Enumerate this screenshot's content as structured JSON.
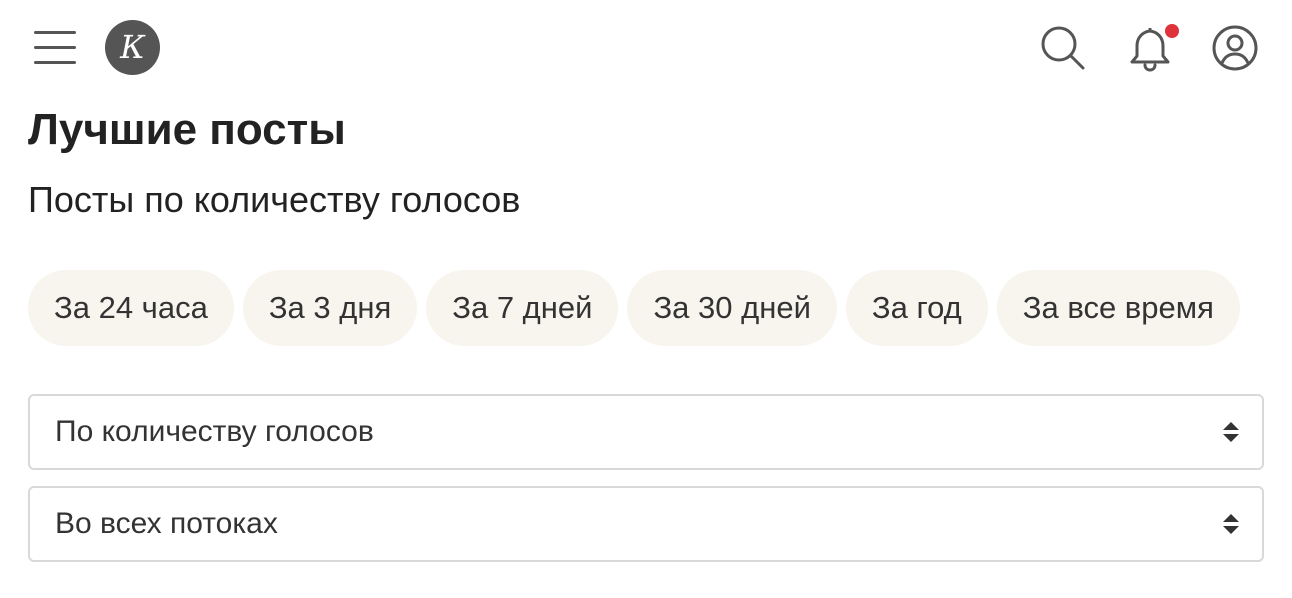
{
  "header": {
    "logo_letter": "К",
    "icons": {
      "menu": "hamburger-menu-icon",
      "search": "search-icon",
      "bell": "bell-icon",
      "user": "user-icon"
    },
    "has_notification": true
  },
  "page": {
    "title": "Лучшие посты",
    "subtitle": "Посты по количеству голосов"
  },
  "period_filters": [
    {
      "label": "За 24 часа"
    },
    {
      "label": "За 3 дня"
    },
    {
      "label": "За 7 дней"
    },
    {
      "label": "За 30 дней"
    },
    {
      "label": "За год"
    },
    {
      "label": "За все время"
    }
  ],
  "selects": {
    "sort": {
      "value": "По количеству голосов"
    },
    "stream": {
      "value": "Во всех потоках"
    }
  },
  "colors": {
    "chip_background": "#f8f5ef",
    "logo_background": "#555555",
    "notification_dot": "#e0323a",
    "text": "#222222"
  }
}
